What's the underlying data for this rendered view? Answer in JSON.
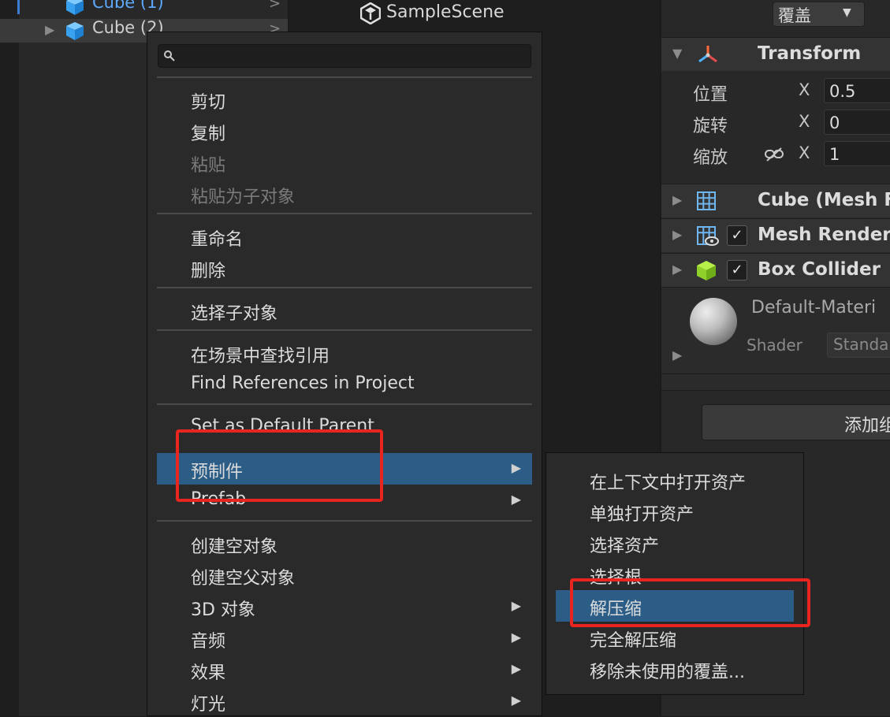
{
  "hierarchy": {
    "items": [
      {
        "label": "Cube (1)",
        "highlight": true
      },
      {
        "label": "Cube (2)",
        "highlight": false
      }
    ]
  },
  "scene": {
    "title": "SampleScene"
  },
  "inspector": {
    "overrides_label": "覆盖",
    "transform": {
      "title": "Transform",
      "rows": [
        {
          "label": "位置",
          "axis": "X",
          "value": "0.5"
        },
        {
          "label": "旋转",
          "axis": "X",
          "value": "0"
        },
        {
          "label": "缩放",
          "axis": "X",
          "value": "1"
        }
      ]
    },
    "components": [
      {
        "title": "Cube (Mesh F"
      },
      {
        "title": "Mesh Render"
      },
      {
        "title": "Box Collider"
      }
    ],
    "material": {
      "name": "Default-Materi",
      "shader_label": "Shader",
      "shader_value": "Standa"
    },
    "add_component_label": "添加组"
  },
  "menu": {
    "search_placeholder": "",
    "items": {
      "cut": "剪切",
      "copy": "复制",
      "paste": "粘贴",
      "paste_as_child": "粘贴为子对象",
      "rename": "重命名",
      "delete": "删除",
      "select_children": "选择子对象",
      "find_refs_scene": "在场景中查找引用",
      "find_refs_project": "Find References in Project",
      "set_default_parent": "Set as Default Parent",
      "prefab_cn": "预制件",
      "prefab_en": "Prefab",
      "create_empty": "创建空对象",
      "create_empty_parent": "创建空父对象",
      "obj3d": "3D 对象",
      "audio": "音频",
      "effects": "效果",
      "light": "灯光"
    }
  },
  "submenu": {
    "items": [
      "在上下文中打开资产",
      "单独打开资产",
      "选择资产",
      "选择根",
      "解压缩",
      "完全解压缩",
      "移除未使用的覆盖..."
    ]
  },
  "colors": {
    "highlight": "#2c5d87",
    "annotation_red": "#e8251f",
    "cube_blue": "#4fb3ff",
    "link_blue": "#5da9ff"
  }
}
